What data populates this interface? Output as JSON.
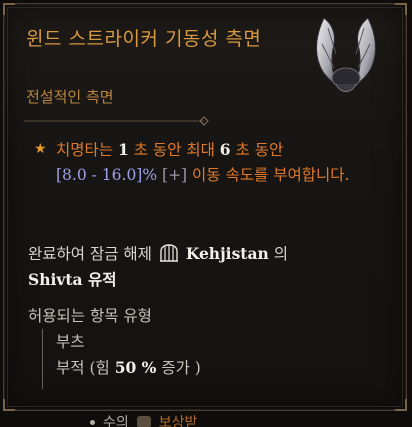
{
  "tooltip": {
    "title": "윈드 스트라이커 기동성 측면",
    "subtitle": "전설적인 측면",
    "item_icon": "silver-wings-icon",
    "affix": {
      "bullet": "★",
      "part1": "치명타는 ",
      "num1": "1",
      "part2": " 초 동안 최대 ",
      "num2": "6",
      "part3": " 초 동안 ",
      "range": "[8.0 - 16.0]%",
      "plus": "[+]",
      "part4": " 이동 속도를 부여합니다."
    },
    "unlock": {
      "prefix": "완료하여 잠금 해제",
      "icon": "gate-icon",
      "location": "Kehjistan",
      "suffix_1": " 의",
      "dungeon": "Shivta",
      "suffix_2": " 유적"
    },
    "allowed": {
      "title": "허용되는 항목 유형",
      "item1": "부츠",
      "item2_prefix": "부적 (힘 ",
      "item2_value": "50 %",
      "item2_suffix": " 증가 )"
    }
  },
  "peek": {
    "prefix": "수의",
    "label": "보상받"
  },
  "colors": {
    "title": "#d89a3e",
    "affix": "#e07a2a",
    "range": "#9fa0e8",
    "background": "#171513"
  }
}
